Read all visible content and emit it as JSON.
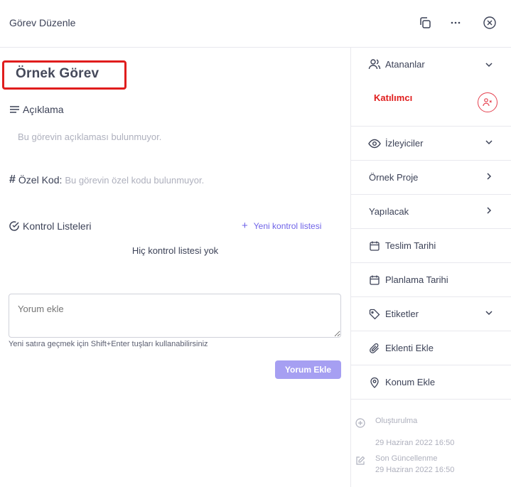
{
  "header": {
    "title": "Görev Düzenle",
    "icons": [
      "copy-icon",
      "more-icon",
      "close-icon"
    ]
  },
  "task": {
    "title": "Örnek Görev"
  },
  "description": {
    "label": "Açıklama",
    "empty": "Bu görevin açıklaması bulunmuyor."
  },
  "custom_code": {
    "label": "Özel Kod:",
    "empty": "Bu görevin özel kodu bulunmuyor."
  },
  "checklists": {
    "label": "Kontrol Listeleri",
    "add_label": "Yeni kontrol listesi",
    "empty": "Hiç kontrol listesi yok"
  },
  "comment": {
    "placeholder": "Yorum ekle",
    "hint": "Yeni satıra geçmek için Shift+Enter tuşları kullanabilirsiniz",
    "submit_label": "Yorum Ekle"
  },
  "sidebar": {
    "assignees_label": "Atananlar",
    "participant_label": "Katılımcı",
    "watchers_label": "İzleyiciler",
    "project_label": "Örnek Proje",
    "status_label": "Yapılacak",
    "due_date_label": "Teslim Tarihi",
    "planning_date_label": "Planlama Tarihi",
    "tags_label": "Etiketler",
    "attachment_label": "Eklenti Ekle",
    "location_label": "Konum Ekle",
    "created_label": "Oluşturulma",
    "created_at": "29 Haziran 2022 16:50",
    "updated_label": "Son Güncellenme",
    "updated_at": "29 Haziran 2022 16:50"
  },
  "colors": {
    "accent": "#6f63e8",
    "button": "#a69ff2",
    "highlight": "#e01d1d"
  }
}
